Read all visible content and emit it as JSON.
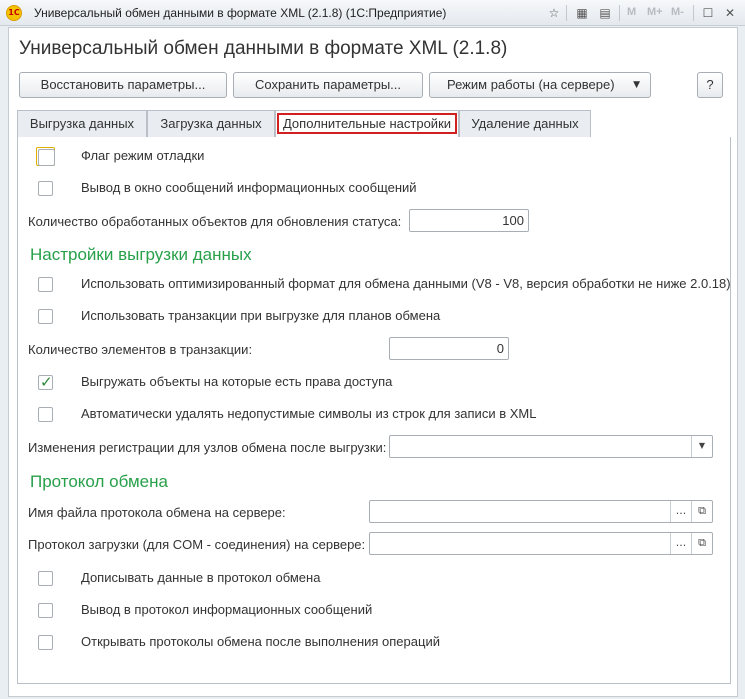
{
  "window": {
    "title": "Универсальный обмен данными в формате XML (2.1.8)  (1С:Предприятие)",
    "app_icon_text": "1С",
    "toolbar_mem": [
      "M",
      "M+",
      "M-"
    ]
  },
  "form": {
    "title": "Универсальный обмен данными в формате XML (2.1.8)"
  },
  "command_bar": {
    "restore_label": "Восстановить параметры...",
    "save_label": "Сохранить параметры...",
    "mode_label": "Режим работы (на сервере)",
    "help_label": "?"
  },
  "tabs": [
    {
      "label": "Выгрузка данных",
      "active": false
    },
    {
      "label": "Загрузка данных",
      "active": false
    },
    {
      "label": "Дополнительные настройки",
      "active": true
    },
    {
      "label": "Удаление данных",
      "active": false
    }
  ],
  "settings": {
    "debug_flag": {
      "label": "Флаг режим отладки",
      "checked": false
    },
    "info_messages": {
      "label": "Вывод в окно сообщений информационных сообщений",
      "checked": false
    },
    "status_count": {
      "label": "Количество обработанных объектов для обновления статуса:",
      "value": "100"
    },
    "export_section": "Настройки выгрузки данных",
    "optimized_format": {
      "label": "Использовать оптимизированный формат для обмена данными (V8 - V8, версия обработки не ниже 2.0.18)",
      "checked": false
    },
    "use_transactions": {
      "label": "Использовать транзакции при выгрузке для планов обмена",
      "checked": false
    },
    "transaction_count": {
      "label": "Количество элементов в транзакции:",
      "value": "0"
    },
    "export_rights": {
      "label": "Выгружать объекты на которые есть права доступа",
      "checked": true
    },
    "remove_invalid": {
      "label": "Автоматически удалять недопустимые символы из строк для записи в XML",
      "checked": false
    },
    "registration_changes": {
      "label": "Изменения регистрации для узлов обмена после выгрузки:",
      "value": ""
    },
    "protocol_section": "Протокол обмена",
    "protocol_file": {
      "label": "Имя файла протокола обмена на сервере:",
      "value": ""
    },
    "com_protocol": {
      "label": "Протокол загрузки (для COM - соединения) на сервере:",
      "value": ""
    },
    "append_protocol": {
      "label": "Дописывать данные в протокол обмена",
      "checked": false
    },
    "protocol_info": {
      "label": "Вывод в протокол информационных сообщений",
      "checked": false
    },
    "open_protocols": {
      "label": "Открывать протоколы обмена после выполнения операций",
      "checked": false
    }
  },
  "colors": {
    "section_header": "#28a04a",
    "active_tab_outline": "#d12020",
    "check_mark": "#2a8a3a"
  }
}
